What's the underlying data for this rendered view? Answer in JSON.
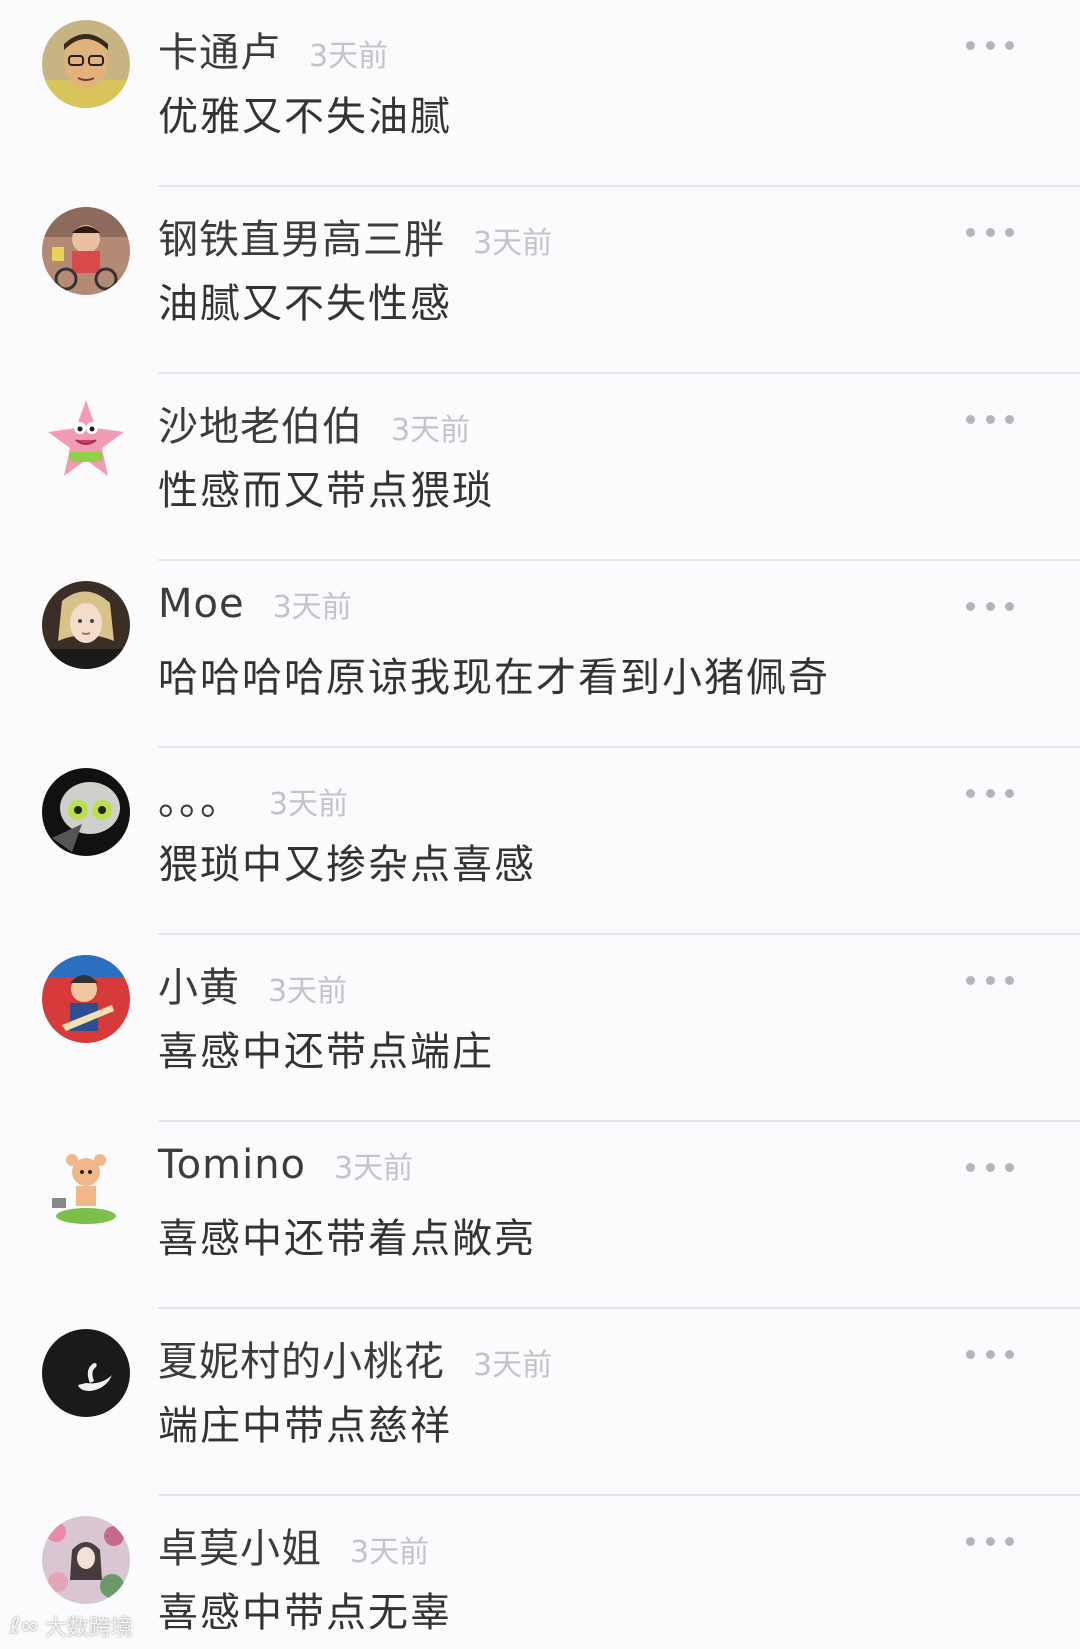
{
  "comments": [
    {
      "name": "卡通卢",
      "time": "3天前",
      "text": "优雅又不失油腻",
      "avatar_icon": "avatar-man-glasses-yellow"
    },
    {
      "name": "钢铁直男高三胖",
      "time": "3天前",
      "text": "油腻又不失性感",
      "avatar_icon": "avatar-child-bike"
    },
    {
      "name": "沙地老伯伯",
      "time": "3天前",
      "text": "性感而又带点猥琐",
      "avatar_icon": "avatar-patrick-star"
    },
    {
      "name": "Moe",
      "time": "3天前",
      "text": "哈哈哈哈原谅我现在才看到小猪佩奇",
      "avatar_icon": "avatar-woman-portrait"
    },
    {
      "name": "。。。",
      "time": "3天前",
      "text": "猥琐中又掺杂点喜感",
      "avatar_icon": "avatar-robot-green"
    },
    {
      "name": "小黄",
      "time": "3天前",
      "text": "喜感中还带点端庄",
      "avatar_icon": "avatar-guitarist-red"
    },
    {
      "name": "Tomino",
      "time": "3天前",
      "text": "喜感中还带着点敞亮",
      "avatar_icon": "avatar-cartoon-mouse"
    },
    {
      "name": "夏妮村的小桃花",
      "time": "3天前",
      "text": "端庄中带点慈祥",
      "avatar_icon": "avatar-swan-black"
    },
    {
      "name": "卓莫小姐",
      "time": "3天前",
      "text": "喜感中带点无辜",
      "avatar_icon": "avatar-girl-flowers"
    }
  ],
  "more_icon": "more-dots-icon",
  "watermark": {
    "text": "大数跨境",
    "logo": "ℓ∞"
  }
}
